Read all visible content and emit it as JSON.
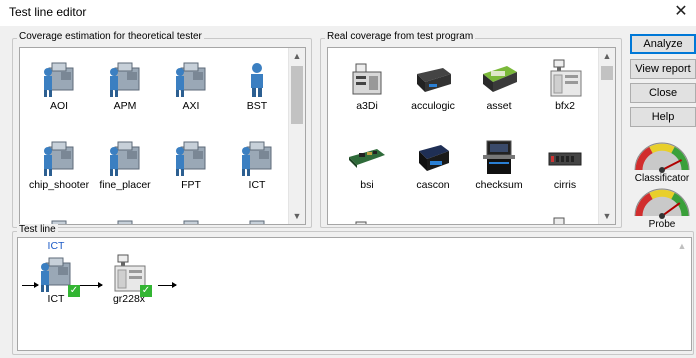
{
  "window": {
    "title": "Test line editor",
    "close_icon": "close-icon"
  },
  "coverage_group": {
    "label": "Coverage estimation for theoretical tester",
    "items": [
      {
        "label": "AOI",
        "icon": "machine-operator-icon"
      },
      {
        "label": "APM",
        "icon": "machine-operator-icon"
      },
      {
        "label": "AXI",
        "icon": "machine-operator-icon"
      },
      {
        "label": "BST",
        "icon": "operator-icon"
      },
      {
        "label": "chip_shooter",
        "icon": "machine-operator-icon"
      },
      {
        "label": "fine_placer",
        "icon": "machine-operator-icon"
      },
      {
        "label": "FPT",
        "icon": "machine-operator-icon"
      },
      {
        "label": "ICT",
        "icon": "machine-operator-icon"
      },
      {
        "label": "",
        "icon": "machine-operator-icon"
      },
      {
        "label": "",
        "icon": "machine-operator-icon"
      },
      {
        "label": "",
        "icon": "machine-operator-icon"
      },
      {
        "label": "",
        "icon": "machine-operator-icon"
      }
    ]
  },
  "real_group": {
    "label": "Real coverage from test program",
    "items": [
      {
        "label": "a3Di",
        "icon": "tester-rack-icon"
      },
      {
        "label": "acculogic",
        "icon": "black-box-icon"
      },
      {
        "label": "asset",
        "icon": "green-box-icon"
      },
      {
        "label": "bfx2",
        "icon": "white-cabinet-icon"
      },
      {
        "label": "bsi",
        "icon": "circuit-board-icon"
      },
      {
        "label": "cascon",
        "icon": "blue-box-icon"
      },
      {
        "label": "checksum",
        "icon": "workstation-icon"
      },
      {
        "label": "cirris",
        "icon": "rack-unit-icon"
      },
      {
        "label": "",
        "icon": "tester-rack-icon"
      },
      {
        "label": "",
        "icon": "black-box-icon"
      },
      {
        "label": "",
        "icon": "green-box-icon"
      },
      {
        "label": "",
        "icon": "white-cabinet-icon"
      }
    ]
  },
  "test_line": {
    "label": "Test line",
    "nodes": [
      {
        "top_label": "ICT",
        "label": "ICT",
        "icon": "machine-operator-icon",
        "checked": true
      },
      {
        "top_label": "",
        "label": "gr228x",
        "icon": "white-cabinet-icon",
        "checked": true
      }
    ]
  },
  "buttons": {
    "analyze": "Analyze",
    "view_report": "View report",
    "close": "Close",
    "help": "Help"
  },
  "gauges": [
    {
      "label": "Classificator",
      "level": 0.85
    },
    {
      "label": "Probe",
      "level": 0.8
    }
  ],
  "colors": {
    "link_blue": "#1e5bc6",
    "check_green": "#33b533",
    "default_border": "#0078d7"
  }
}
